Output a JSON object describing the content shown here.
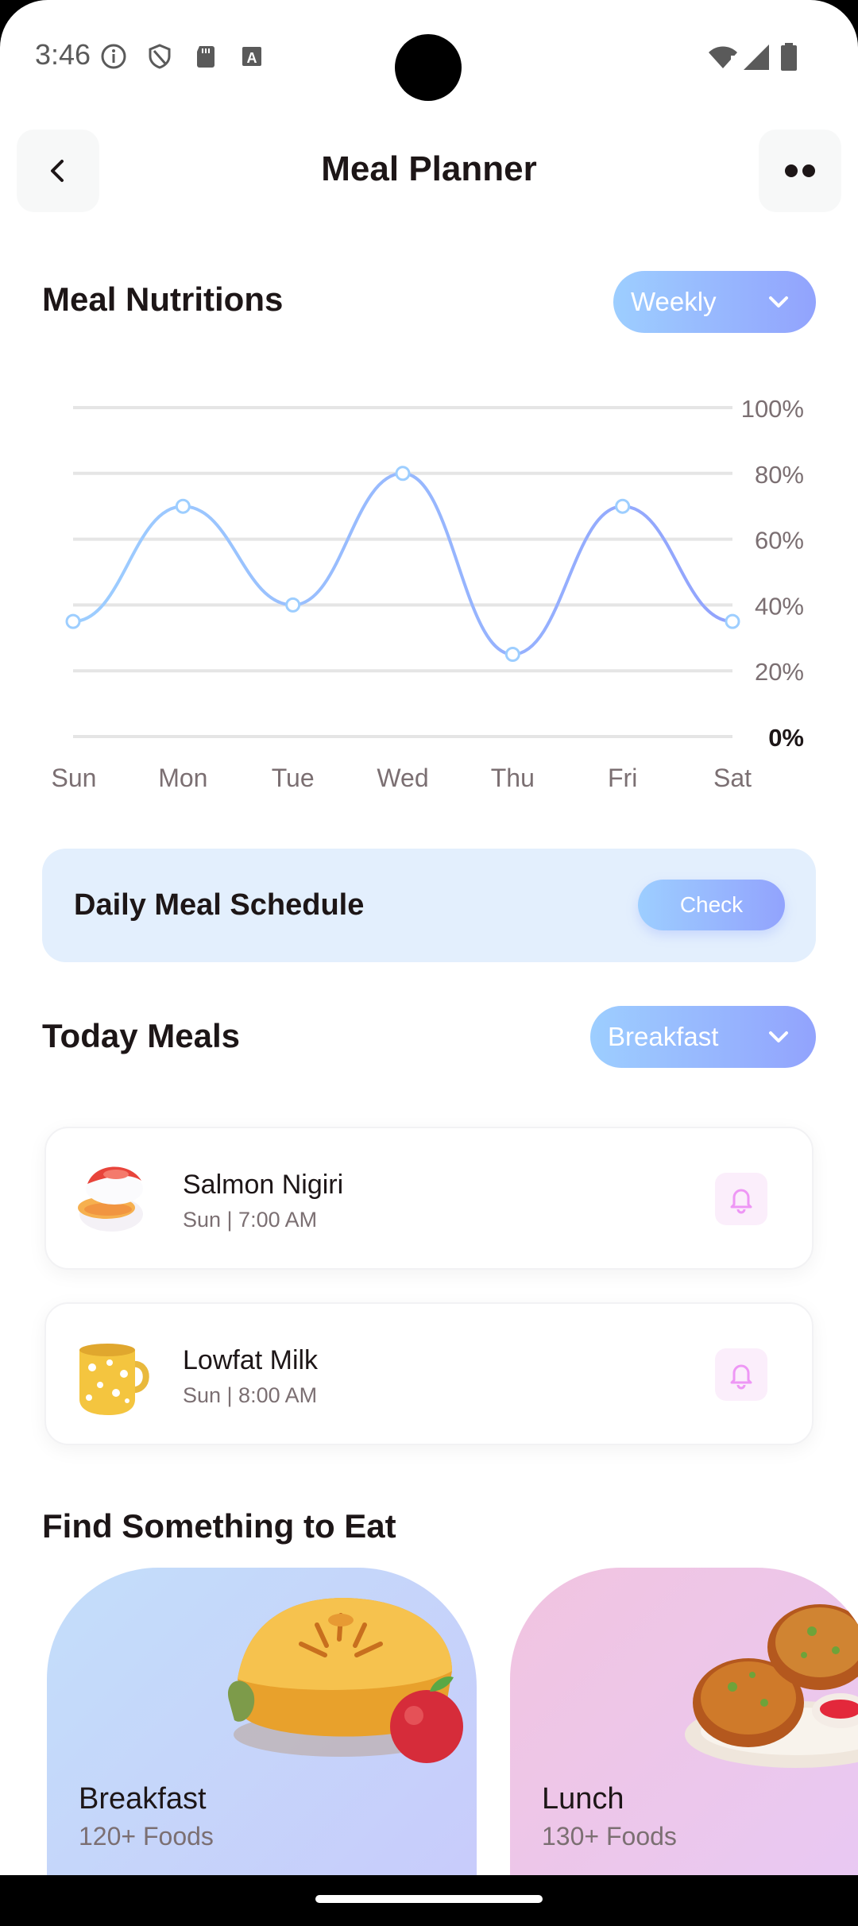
{
  "status_bar": {
    "time": "3:46"
  },
  "header": {
    "title": "Meal Planner"
  },
  "nutrition": {
    "title": "Meal Nutritions",
    "period_select": "Weekly"
  },
  "chart_data": {
    "type": "line",
    "categories": [
      "Sun",
      "Mon",
      "Tue",
      "Wed",
      "Thu",
      "Fri",
      "Sat"
    ],
    "series": [
      {
        "values": [
          35,
          70,
          40,
          80,
          25,
          70,
          35
        ]
      }
    ],
    "ytick_labels": [
      "0%",
      "20%",
      "40%",
      "60%",
      "80%",
      "100%"
    ],
    "ylim": [
      0,
      100
    ],
    "grid": true,
    "title": "",
    "xlabel": "",
    "ylabel": "",
    "colors": {
      "line_start": "#9DCEFF",
      "line_end": "#92A3FD",
      "grid": "#E5E5E5"
    }
  },
  "schedule": {
    "label": "Daily Meal Schedule",
    "button": "Check"
  },
  "today_meals": {
    "title": "Today Meals",
    "meal_select": "Breakfast",
    "items": [
      {
        "name": "Salmon Nigiri",
        "time": "Sun | 7:00 AM",
        "icon": "salmon-nigiri-image"
      },
      {
        "name": "Lowfat Milk",
        "time": "Sun | 8:00 AM",
        "icon": "milk-cup-image"
      }
    ]
  },
  "find": {
    "title": "Find Something to Eat",
    "cards": [
      {
        "name": "Breakfast",
        "count": "120+ Foods",
        "icon": "pie-image"
      },
      {
        "name": "Lunch",
        "count": "130+ Foods",
        "icon": "fried-patties-image"
      }
    ]
  },
  "theme": {
    "accent_start": "#9DCEFF",
    "accent_end": "#92A3FD",
    "text": "#1D1617",
    "muted": "#7B6F72"
  }
}
